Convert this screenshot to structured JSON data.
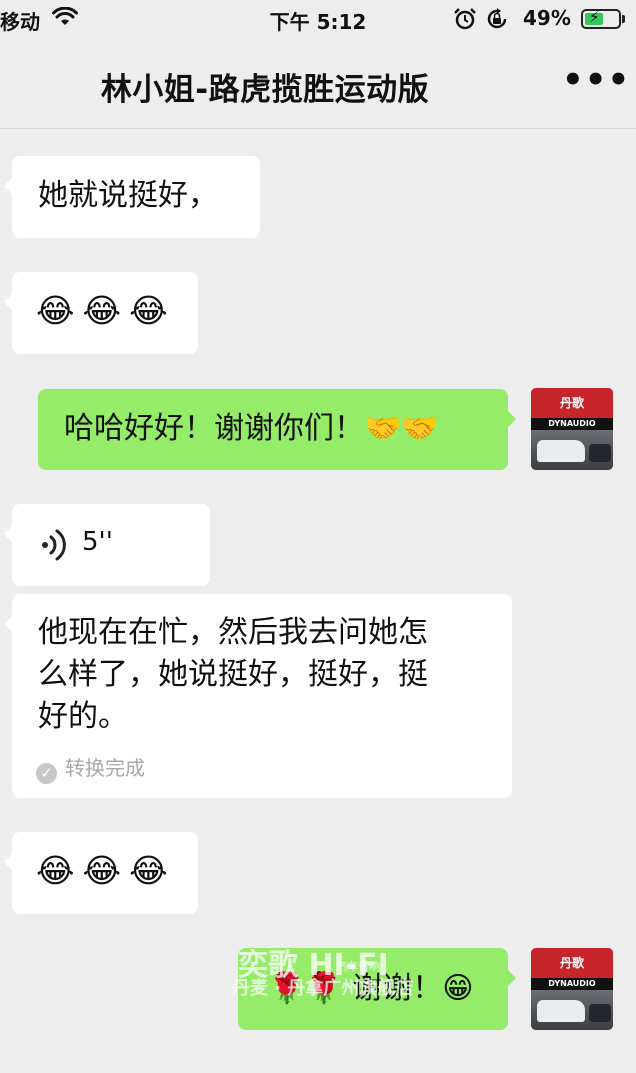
{
  "status_bar": {
    "carrier": "移动",
    "time": "下午 5:12",
    "battery_percent": "49%",
    "battery_level": 0.49,
    "icons": [
      "wifi-icon",
      "alarm-icon",
      "orientation-lock-icon",
      "battery-charging-icon"
    ]
  },
  "nav": {
    "title": "林小姐-路虎揽胜运动版",
    "more": "•••"
  },
  "messages": [
    {
      "side": "in",
      "type": "text",
      "text": "她就说挺好，"
    },
    {
      "side": "in",
      "type": "emoji",
      "text": "😂😂😂"
    },
    {
      "side": "out",
      "type": "text",
      "text": "哈哈好好！谢谢你们！🤝🤝"
    },
    {
      "side": "in",
      "type": "voice",
      "duration": "5''"
    },
    {
      "side": "in",
      "type": "transcript",
      "lines": [
        "他现在在忙，然后我去问她怎",
        "么样了，她说挺好，挺好，挺",
        "好的。"
      ],
      "status": "转换完成"
    },
    {
      "side": "in",
      "type": "emoji",
      "text": "😂😂😂"
    },
    {
      "side": "out",
      "type": "text",
      "text": "🌹🌹 谢谢！😁"
    }
  ],
  "avatar": {
    "sign_text": "丹歌",
    "brand": "DYNAUDIO"
  },
  "watermark": {
    "logo": "奕歌 HI-FI",
    "sub": "汽车音响",
    "line": "丹麦 · 丹拿广州旗舰店"
  },
  "colors": {
    "background": "#ededed",
    "incoming_bubble": "#ffffff",
    "outgoing_bubble": "#95ec69",
    "battery_fill": "#35c759"
  }
}
